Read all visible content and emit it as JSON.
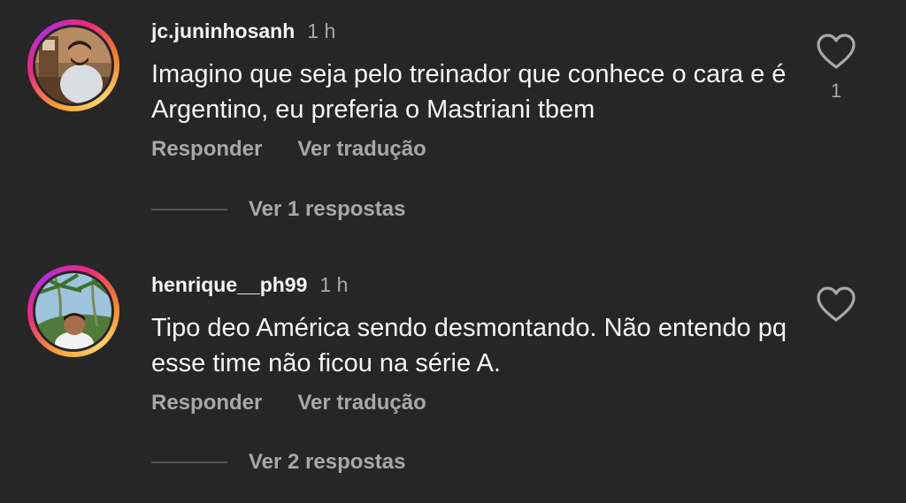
{
  "comments": [
    {
      "username": "jc.juninhosanh",
      "time": "1 h",
      "text": "Imagino que seja pelo treinador que conhece o cara e é Argentino, eu preferia o Mastriani tbem",
      "reply_label": "Responder",
      "translate_label": "Ver tradução",
      "view_replies_label": "Ver 1 respostas",
      "like_count": "1",
      "icon": "heart-icon"
    },
    {
      "username": "henrique__ph99",
      "time": "1 h",
      "text": "Tipo deo América sendo desmontando. Não entendo pq esse time não ficou na série A.",
      "reply_label": "Responder",
      "translate_label": "Ver tradução",
      "view_replies_label": "Ver 2 respostas",
      "like_count": "",
      "icon": "heart-icon"
    }
  ],
  "colors": {
    "background": "#262626",
    "text_primary": "#f5f5f5",
    "text_secondary": "#a8a8a8",
    "story_ring": [
      "#f9a43a",
      "#ee2a7b",
      "#b62bd6"
    ]
  }
}
